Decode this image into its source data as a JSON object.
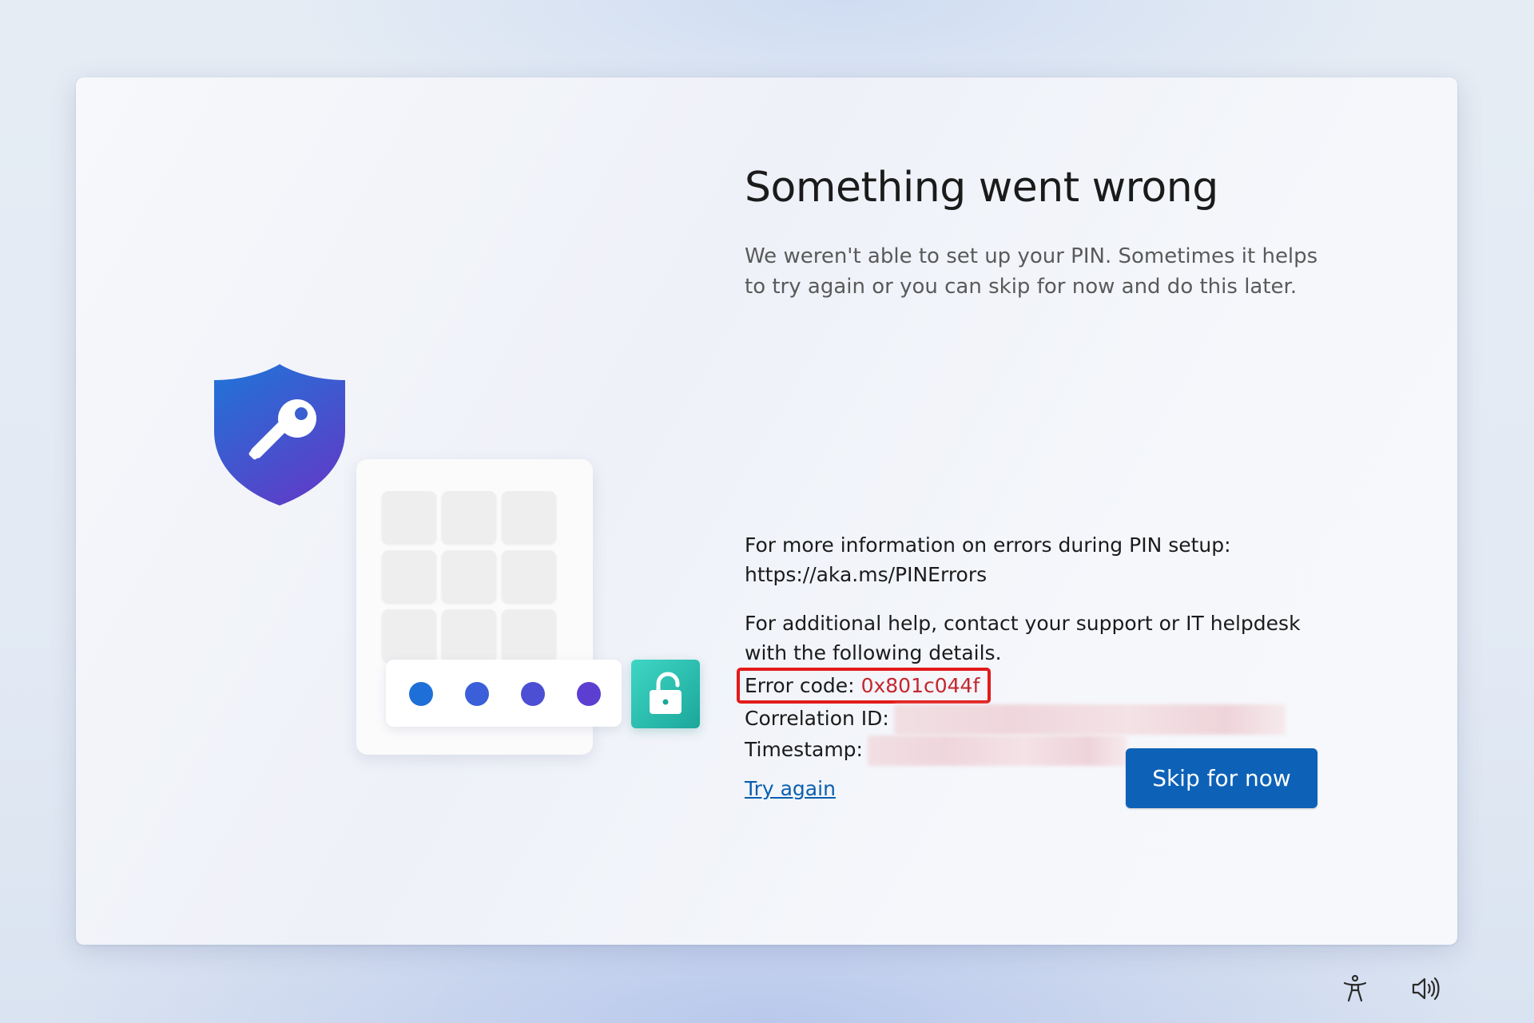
{
  "dialog": {
    "title": "Something went wrong",
    "subtitle": "We weren't able to set up your PIN. Sometimes it helps to try again or you can skip for now and do this later.",
    "more_info_line1": "For more information on errors during PIN setup:",
    "more_info_link": "https://aka.ms/PINErrors",
    "help_text": "For additional help, contact your support or IT helpdesk with the following details.",
    "error_code_label": "Error code:",
    "error_code_value": "0x801c044f",
    "correlation_label": "Correlation ID:",
    "timestamp_label": "Timestamp:",
    "try_again_label": "Try again",
    "skip_button_label": "Skip for now"
  },
  "illustration": {
    "shield_icon": "shield-key-icon",
    "lock_icon": "unlocked-padlock-icon",
    "pin_dots": 4,
    "keypad_keys": 9
  },
  "tray": {
    "accessibility_icon": "accessibility-icon",
    "volume_icon": "speaker-volume-icon"
  },
  "colors": {
    "primary_button": "#0d62b8",
    "link": "#0a5fb0",
    "error_highlight": "#e21b1b",
    "error_value": "#c4262e",
    "lock_tile": "#2cc3b3"
  }
}
